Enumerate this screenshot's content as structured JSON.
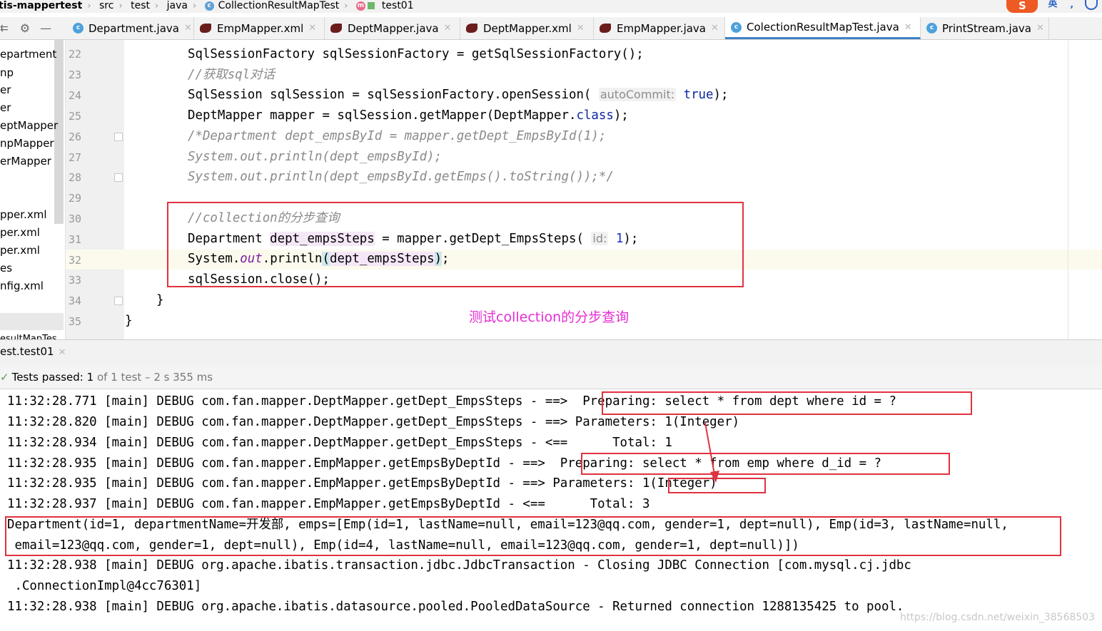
{
  "breadcrumb": {
    "items": [
      "tis-mappertest",
      "src",
      "test",
      "java",
      "CollectionResultMapTest",
      "test01"
    ]
  },
  "ime": {
    "sogou": "S",
    "mode": "英"
  },
  "tabs": [
    {
      "label": "Department.java",
      "icon": "class-icon"
    },
    {
      "label": "EmpMapper.xml",
      "icon": "mybatis-icon"
    },
    {
      "label": "DeptMapper.java",
      "icon": "mybatis-icon"
    },
    {
      "label": "DeptMapper.xml",
      "icon": "mybatis-icon"
    },
    {
      "label": "EmpMapper.java",
      "icon": "mybatis-icon"
    },
    {
      "label": "ColectionResultMapTest.java",
      "icon": "class-icon",
      "active": true
    },
    {
      "label": "PrintStream.java",
      "icon": "class-icon"
    }
  ],
  "project": {
    "items": [
      "epartment",
      "np",
      "er",
      "er",
      "eptMapper",
      "npMapper",
      "erMapper",
      "pper.xml",
      "per.xml",
      "per.xml",
      "es",
      "nfig.xml"
    ],
    "bottom_tab": "esultMapTes"
  },
  "editor": {
    "line_numbers": [
      "22",
      "23",
      "24",
      "25",
      "26",
      "27",
      "28",
      "29",
      "30",
      "31",
      "32",
      "33",
      "34",
      "35"
    ],
    "annotation": "测试collection的分步查询"
  },
  "run": {
    "tab_label": "est.test01",
    "status_passed": "Tests passed:",
    "status_count": "1",
    "status_rest": "of 1 test – 2 s 355 ms",
    "logs": [
      "11:32:28.771 [main] DEBUG com.fan.mapper.DeptMapper.getDept_EmpsSteps - ==>  Preparing: select * from dept where id = ?",
      "11:32:28.820 [main] DEBUG com.fan.mapper.DeptMapper.getDept_EmpsSteps - ==> Parameters: 1(Integer)",
      "11:32:28.934 [main] DEBUG com.fan.mapper.DeptMapper.getDept_EmpsSteps - <==      Total: 1",
      "11:32:28.935 [main] DEBUG com.fan.mapper.EmpMapper.getEmpsByDeptId - ==>  Preparing: select * from emp where d_id = ?",
      "11:32:28.935 [main] DEBUG com.fan.mapper.EmpMapper.getEmpsByDeptId - ==> Parameters: 1(Integer)",
      "11:32:28.937 [main] DEBUG com.fan.mapper.EmpMapper.getEmpsByDeptId - <==      Total: 3",
      "Department(id=1, departmentName=开发部, emps=[Emp(id=1, lastName=null, email=123@qq.com, gender=1, dept=null), Emp(id=3, lastName=null,",
      " email=123@qq.com, gender=1, dept=null), Emp(id=4, lastName=null, email=123@qq.com, gender=1, dept=null)])",
      "11:32:28.938 [main] DEBUG org.apache.ibatis.transaction.jdbc.JdbcTransaction - Closing JDBC Connection [com.mysql.cj.jdbc",
      " .ConnectionImpl@4cc76301]",
      "11:32:28.938 [main] DEBUG org.apache.ibatis.datasource.pooled.PooledDataSource - Returned connection 1288135425 to pool."
    ]
  },
  "watermark": "https://blog.csdn.net/weixin_38568503",
  "colors": {
    "accent": "#4083c9",
    "highlight_box": "#e0323f",
    "annotation": "#e62cd3",
    "keyword": "#0d27a0"
  }
}
